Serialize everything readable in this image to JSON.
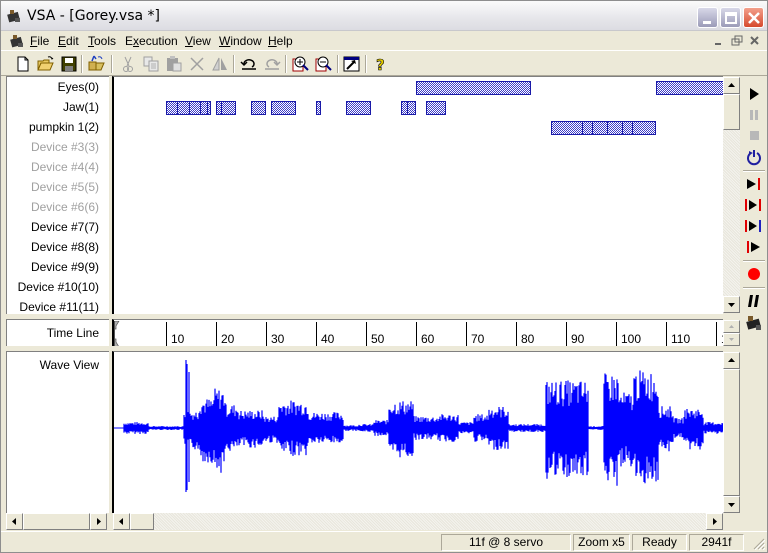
{
  "window": {
    "title": "VSA - [Gorey.vsa *]",
    "controls": [
      "minimize",
      "maximize",
      "close"
    ]
  },
  "menubar": {
    "items": [
      {
        "label": "File",
        "accel": "F"
      },
      {
        "label": "Edit",
        "accel": "E"
      },
      {
        "label": "Tools",
        "accel": "T"
      },
      {
        "label": "Execution",
        "accel": "x"
      },
      {
        "label": "View",
        "accel": "V"
      },
      {
        "label": "Window",
        "accel": "W"
      },
      {
        "label": "Help",
        "accel": "H"
      }
    ],
    "mdi_controls": [
      "minimize",
      "restore",
      "close"
    ]
  },
  "toolbar": {
    "buttons": [
      {
        "name": "new-file",
        "icon": "new-document-icon",
        "enabled": true
      },
      {
        "name": "open-file",
        "icon": "open-folder-icon",
        "enabled": true
      },
      {
        "name": "save-file",
        "icon": "floppy-disk-icon",
        "enabled": true
      },
      {
        "name": "import",
        "icon": "import-folder-icon",
        "enabled": true
      },
      {
        "name": "cut",
        "icon": "scissors-icon",
        "enabled": false
      },
      {
        "name": "copy",
        "icon": "copy-icon",
        "enabled": false
      },
      {
        "name": "paste",
        "icon": "paste-icon",
        "enabled": false
      },
      {
        "name": "delete",
        "icon": "delete-x-icon",
        "enabled": false
      },
      {
        "name": "mirror",
        "icon": "mirror-icon",
        "enabled": false
      },
      {
        "name": "undo",
        "icon": "undo-icon",
        "enabled": true
      },
      {
        "name": "redo",
        "icon": "redo-icon",
        "enabled": false
      },
      {
        "name": "zoom-in",
        "icon": "zoom-in-icon",
        "enabled": true
      },
      {
        "name": "zoom-out",
        "icon": "zoom-out-icon",
        "enabled": true
      },
      {
        "name": "tool-settings",
        "icon": "hammer-window-icon",
        "enabled": true
      },
      {
        "name": "help",
        "icon": "question-mark-icon",
        "enabled": true
      }
    ]
  },
  "tracks": [
    {
      "label": "Eyes(0)",
      "enabled": true,
      "blocks": [
        {
          "start": 60,
          "end": 83,
          "divs": []
        },
        {
          "start": 108,
          "end": 122,
          "divs": []
        }
      ]
    },
    {
      "label": "Jaw(1)",
      "enabled": true,
      "blocks": [
        {
          "start": 10,
          "end": 19,
          "divs": [
            12,
            14.3,
            16.6,
            18
          ]
        },
        {
          "start": 20,
          "end": 24,
          "divs": [
            20.7
          ]
        },
        {
          "start": 27,
          "end": 30,
          "divs": []
        },
        {
          "start": 31,
          "end": 36,
          "divs": []
        },
        {
          "start": 40,
          "end": 41,
          "divs": []
        },
        {
          "start": 46,
          "end": 51,
          "divs": []
        },
        {
          "start": 57,
          "end": 60,
          "divs": [
            58
          ]
        },
        {
          "start": 62,
          "end": 66,
          "divs": []
        }
      ]
    },
    {
      "label": "pumpkin 1(2)",
      "enabled": true,
      "blocks": [
        {
          "start": 87,
          "end": 108,
          "divs": [
            93,
            95,
            98,
            101,
            103
          ]
        }
      ]
    },
    {
      "label": "Device #3(3)",
      "enabled": false,
      "blocks": []
    },
    {
      "label": "Device #4(4)",
      "enabled": false,
      "blocks": []
    },
    {
      "label": "Device #5(5)",
      "enabled": false,
      "blocks": []
    },
    {
      "label": "Device #6(6)",
      "enabled": false,
      "blocks": []
    },
    {
      "label": "Device #7(7)",
      "enabled": true,
      "blocks": []
    },
    {
      "label": "Device #8(8)",
      "enabled": true,
      "blocks": []
    },
    {
      "label": "Device #9(9)",
      "enabled": true,
      "blocks": []
    },
    {
      "label": "Device #10(10)",
      "enabled": true,
      "blocks": []
    },
    {
      "label": "Device #11(11)",
      "enabled": true,
      "blocks": []
    }
  ],
  "timeline": {
    "label": "Time Line",
    "ticks": [
      "10",
      "20",
      "30",
      "40",
      "50",
      "60",
      "70",
      "80",
      "90",
      "100",
      "110",
      "1"
    ]
  },
  "waveview": {
    "label": "Wave View"
  },
  "transport": {
    "buttons": [
      {
        "name": "play",
        "icon": "play-icon",
        "enabled": true
      },
      {
        "name": "pause",
        "icon": "pause-icon",
        "enabled": false
      },
      {
        "name": "stop",
        "icon": "stop-icon",
        "enabled": false
      },
      {
        "name": "loop",
        "icon": "loop-icon",
        "enabled": true
      },
      {
        "name": "play-to-end",
        "icon": "play-to-marker-icon",
        "enabled": true
      },
      {
        "name": "play-between-markers",
        "icon": "play-between-markers-icon",
        "enabled": true
      },
      {
        "name": "play-from-marker-to-end",
        "icon": "play-from-marker-icon",
        "enabled": true
      },
      {
        "name": "play-from-marker",
        "icon": "play-from-start-marker-icon",
        "enabled": true
      },
      {
        "name": "record",
        "icon": "record-icon",
        "enabled": true
      },
      {
        "name": "fast-pause",
        "icon": "double-bar-icon",
        "enabled": true
      },
      {
        "name": "servo",
        "icon": "servo-icon",
        "enabled": true
      }
    ]
  },
  "statusbar": {
    "frames_info": "11f @ 8 servo",
    "zoom": "Zoom x5",
    "status": "Ready",
    "total_frames": "2941f"
  },
  "colors": {
    "block_fill": "#3c3cc8",
    "block_border": "#1a1aa8",
    "wave": "#0000ff",
    "record_red": "#ff0000",
    "disabled_text": "#a0a0a0"
  }
}
